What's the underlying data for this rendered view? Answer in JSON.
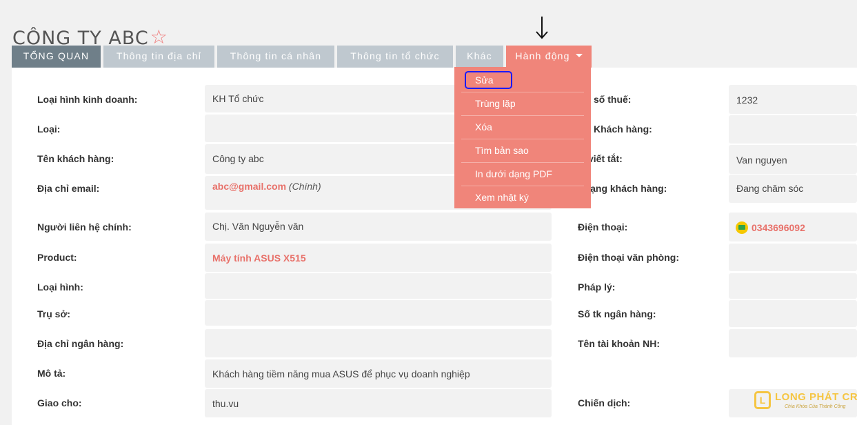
{
  "header": {
    "title": "CÔNG TY ABC",
    "star": "☆"
  },
  "tabs": [
    {
      "label": "TỔNG QUAN"
    },
    {
      "label": "Thông tin địa chỉ"
    },
    {
      "label": "Thông tin cá nhân"
    },
    {
      "label": "Thông tin tổ chức"
    },
    {
      "label": "Khác"
    },
    {
      "label": "Hành động"
    }
  ],
  "action_menu": {
    "items": [
      {
        "label": "Sửa"
      },
      {
        "label": "Trùng lặp"
      },
      {
        "label": "Xóa"
      },
      {
        "label": "Tìm bản sao"
      },
      {
        "label": "In dưới dạng PDF"
      },
      {
        "label": "Xem nhật ký"
      }
    ]
  },
  "fields_left": [
    {
      "label": "Loại hình kinh doanh:",
      "value": "KH Tổ chức"
    },
    {
      "label": "Loại:",
      "value": ""
    },
    {
      "label": "Tên khách hàng:",
      "value": "Công ty abc"
    },
    {
      "label": "Địa chỉ email:",
      "value": "abc@gmail.com",
      "note": "(Chính)"
    },
    {
      "label": "Người liên hệ  chính:",
      "value": "Chị. Văn Nguyễn văn"
    },
    {
      "label": "Product:",
      "value": "Máy tính ASUS X515"
    },
    {
      "label": "Loại hình:",
      "value": ""
    },
    {
      "label": "Trụ sở:",
      "value": ""
    },
    {
      "label": "Địa chỉ ngân hàng:",
      "value": ""
    },
    {
      "label": "Mô tả:",
      "value": "Khách hàng tiềm năng mua ASUS để phục vụ doanh nghiệp"
    },
    {
      "label": "Giao cho:",
      "value": "thu.vu"
    }
  ],
  "fields_right": [
    {
      "label": "số thuế:",
      "value": "1232"
    },
    {
      "label": "Khách hàng:",
      "value": ""
    },
    {
      "label": "viết tắt:",
      "value": "Van nguyen"
    },
    {
      "label": "trạng khách hàng:",
      "value": "Đang chăm sóc"
    },
    {
      "label": "Điện thoại:",
      "value": "0343696092"
    },
    {
      "label": "Điện thoại văn phòng:",
      "value": ""
    },
    {
      "label": "Pháp lý:",
      "value": ""
    },
    {
      "label": "Số tk ngân hàng:",
      "value": ""
    },
    {
      "label": "Tên tài khoản NH:",
      "value": ""
    },
    {
      "label": "Chiến dịch:",
      "value": ""
    }
  ],
  "logo": {
    "mark": "L",
    "name": "LONG PHÁT CRM",
    "tagline": "Chìa Khóa Của Thành Công"
  },
  "colors": {
    "accent": "#f0857a",
    "active_tab": "#6f7f89",
    "tab": "#bfc8cf",
    "link": "#e8716a",
    "annotation": "#1a1aff"
  },
  "icons": {
    "favorite": "star-icon",
    "phone": "chat-phone-icon",
    "caret": "caret-down-icon",
    "annotation": "down-arrow-annotation"
  }
}
